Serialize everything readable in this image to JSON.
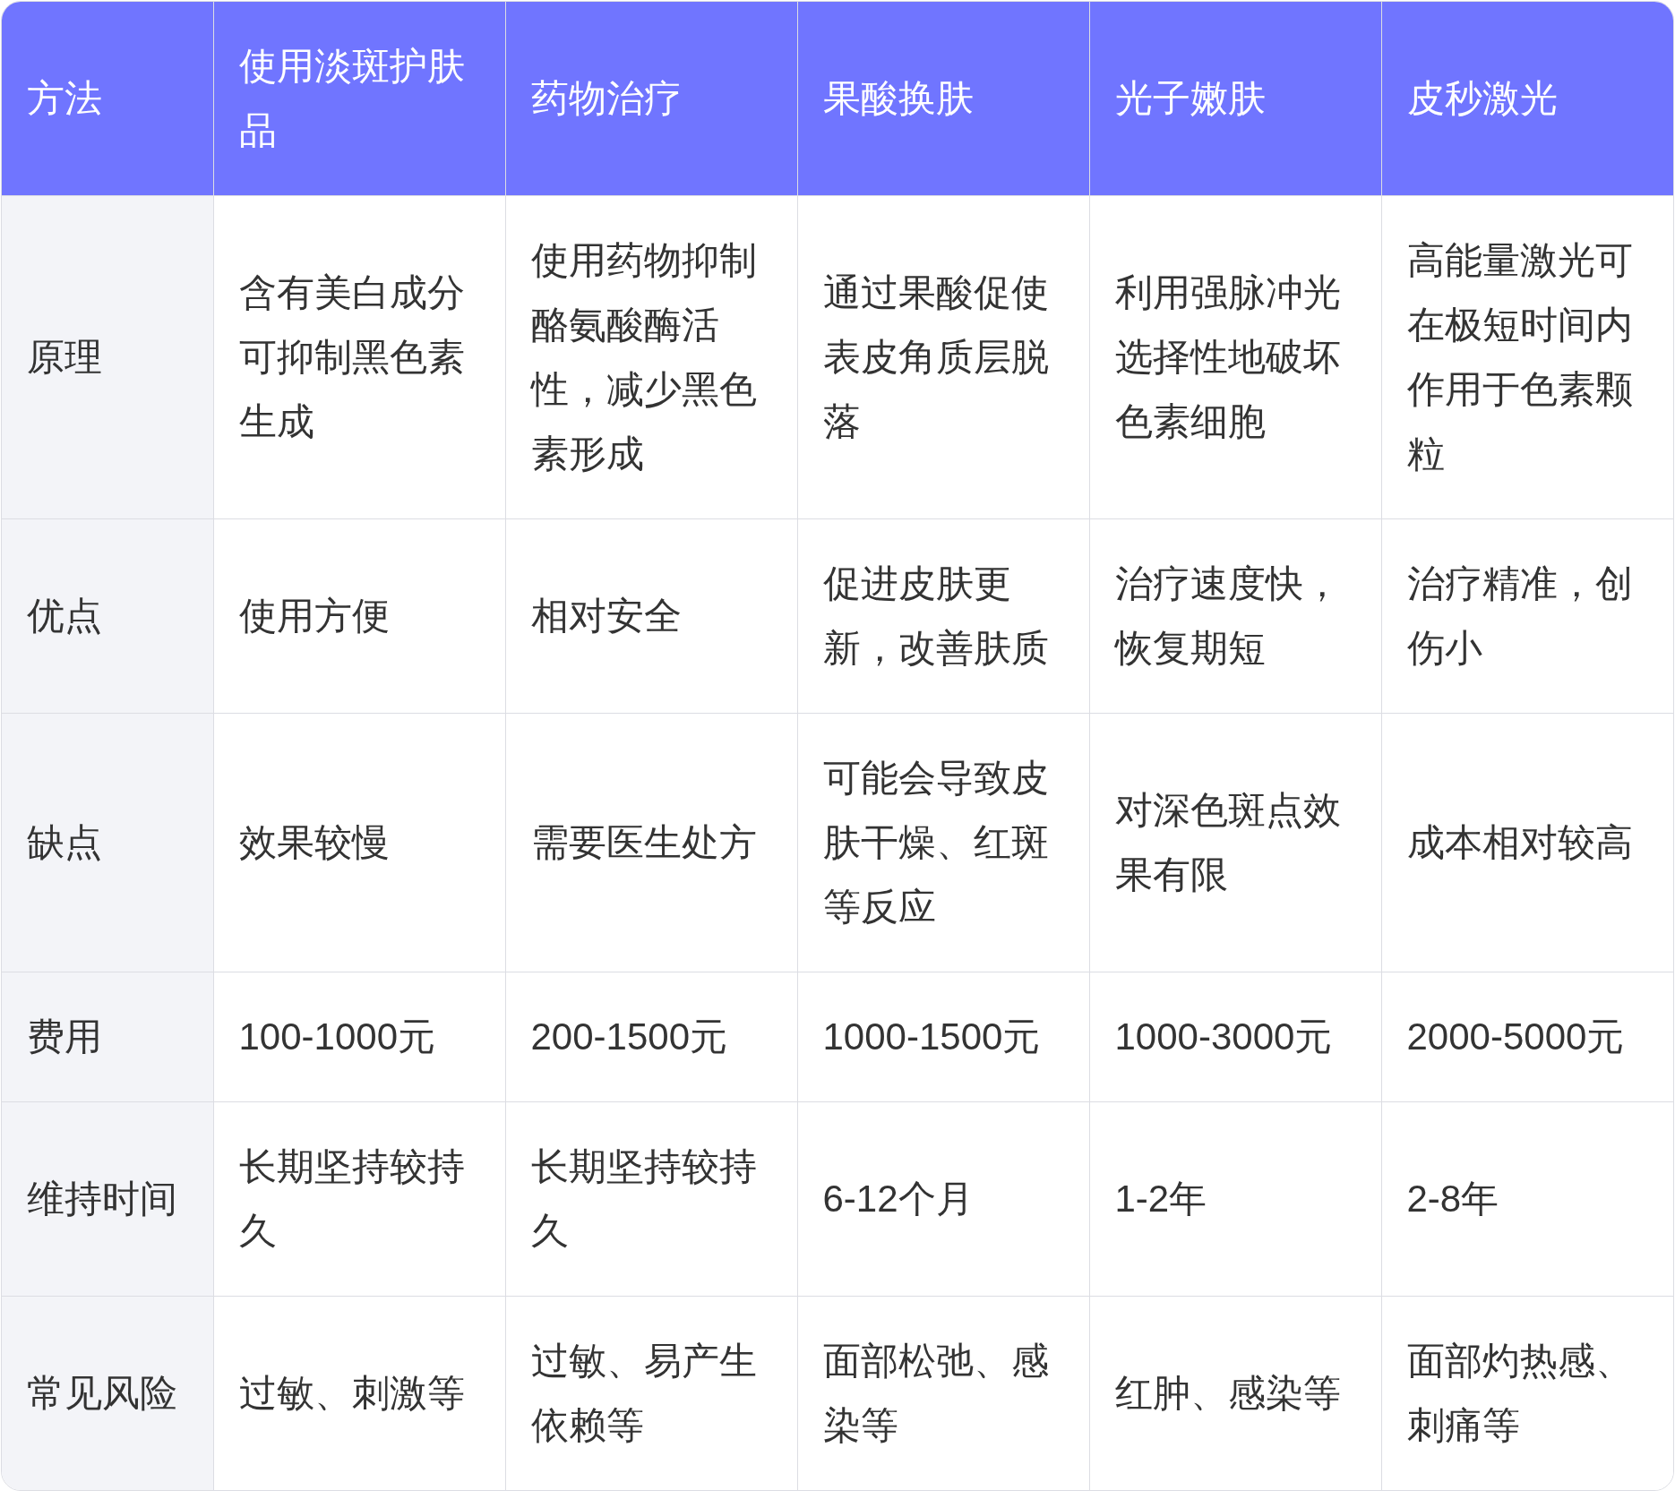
{
  "table": {
    "columns": [
      "方法",
      "使用淡斑护肤品",
      "药物治疗",
      "果酸换肤",
      "光子嫩肤",
      "皮秒激光"
    ],
    "rows": [
      {
        "cells": [
          "原理",
          "含有美白成分可抑制黑色素生成",
          "使用药物抑制酪氨酸酶活性，减少黑色素形成",
          "通过果酸促使表皮角质层脱落",
          "利用强脉冲光选择性地破坏色素细胞",
          "高能量激光可在极短时间内作用于色素颗粒"
        ]
      },
      {
        "cells": [
          "优点",
          "使用方便",
          "相对安全",
          "促进皮肤更新，改善肤质",
          "治疗速度快，恢复期短",
          "治疗精准，创伤小"
        ]
      },
      {
        "cells": [
          "缺点",
          "效果较慢",
          "需要医生处方",
          "可能会导致皮肤干燥、红斑等反应",
          "对深色斑点效果有限",
          "成本相对较高"
        ]
      },
      {
        "cells": [
          "费用",
          "100-1000元",
          "200-1500元",
          "1000-1500元",
          "1000-3000元",
          "2000-5000元"
        ]
      },
      {
        "cells": [
          "维持时间",
          "长期坚持较持久",
          "长期坚持较持久",
          "6-12个月",
          "1-2年",
          "2-8年"
        ]
      },
      {
        "cells": [
          "常见风险",
          "过敏、刺激等",
          "过敏、易产生依赖等",
          "面部松弛、感染等",
          "红肿、感染等",
          "面部灼热感、刺痛等"
        ]
      }
    ]
  }
}
